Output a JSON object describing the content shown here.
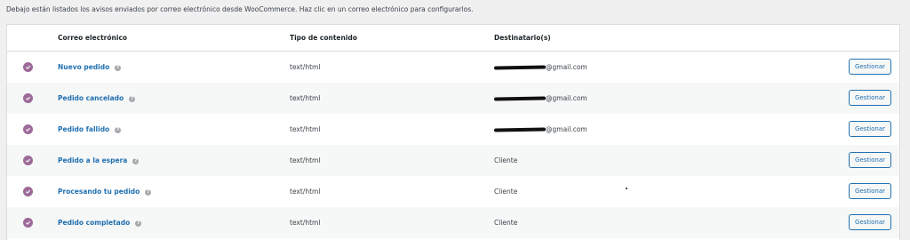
{
  "intro_text": "Debajo están listados los avisos enviados por correo electrónico desde WooCommerce. Haz clic en un correo electrónico para configurarlos.",
  "table": {
    "headers": {
      "email": "Correo electrónico",
      "content_type": "Tipo de contenido",
      "recipients": "Destinatario(s)"
    },
    "rows": [
      {
        "name": "Nuevo pedido",
        "content_type": "text/html",
        "recipient": "@gmail.com",
        "recipient_redacted": true,
        "action": "Gestionar",
        "enabled": true
      },
      {
        "name": "Pedido cancelado",
        "content_type": "text/html",
        "recipient": "@gmail.com",
        "recipient_redacted": true,
        "action": "Gestionar",
        "enabled": true
      },
      {
        "name": "Pedido fallido",
        "content_type": "text/html",
        "recipient": "@gmail.com",
        "recipient_redacted": true,
        "action": "Gestionar",
        "enabled": true
      },
      {
        "name": "Pedido a la espera",
        "content_type": "text/html",
        "recipient": "Cliente",
        "recipient_redacted": false,
        "action": "Gestionar",
        "enabled": true
      },
      {
        "name": "Procesando tu pedido",
        "content_type": "text/html",
        "recipient": "Cliente",
        "recipient_redacted": false,
        "action": "Gestionar",
        "enabled": true
      },
      {
        "name": "Pedido completado",
        "content_type": "text/html",
        "recipient": "Cliente",
        "recipient_redacted": false,
        "action": "Gestionar",
        "enabled": true
      }
    ]
  },
  "help_glyph": "?",
  "colors": {
    "status_enabled": "#9c6b99",
    "link": "#2271b1"
  }
}
